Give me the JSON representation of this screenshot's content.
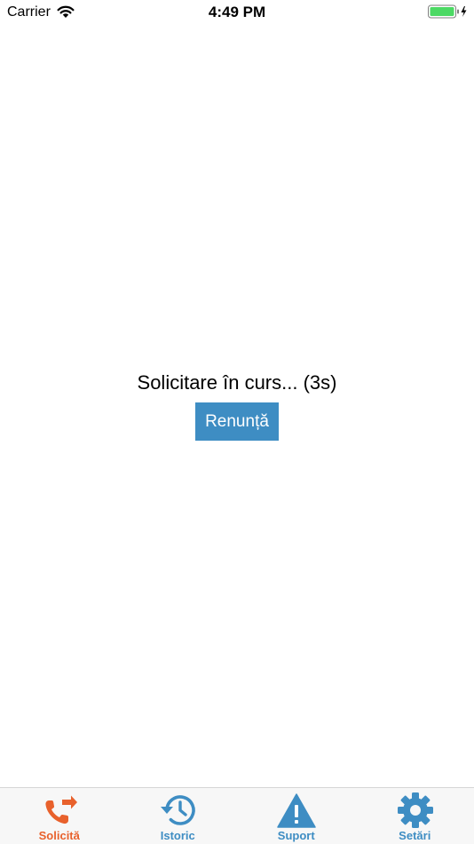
{
  "status_bar": {
    "carrier": "Carrier",
    "time": "4:49 PM"
  },
  "main": {
    "progress_text": "Solicitare în curs... (3s)",
    "cancel_label": "Renunță"
  },
  "tabs": [
    {
      "label": "Solicită",
      "icon": "phone-transfer-icon",
      "active": true
    },
    {
      "label": "Istoric",
      "icon": "history-icon",
      "active": false
    },
    {
      "label": "Suport",
      "icon": "warning-icon",
      "active": false
    },
    {
      "label": "Setări",
      "icon": "gear-icon",
      "active": false
    }
  ],
  "colors": {
    "active": "#e8612c",
    "accent": "#3e8dc3",
    "battery": "#4cd964"
  }
}
